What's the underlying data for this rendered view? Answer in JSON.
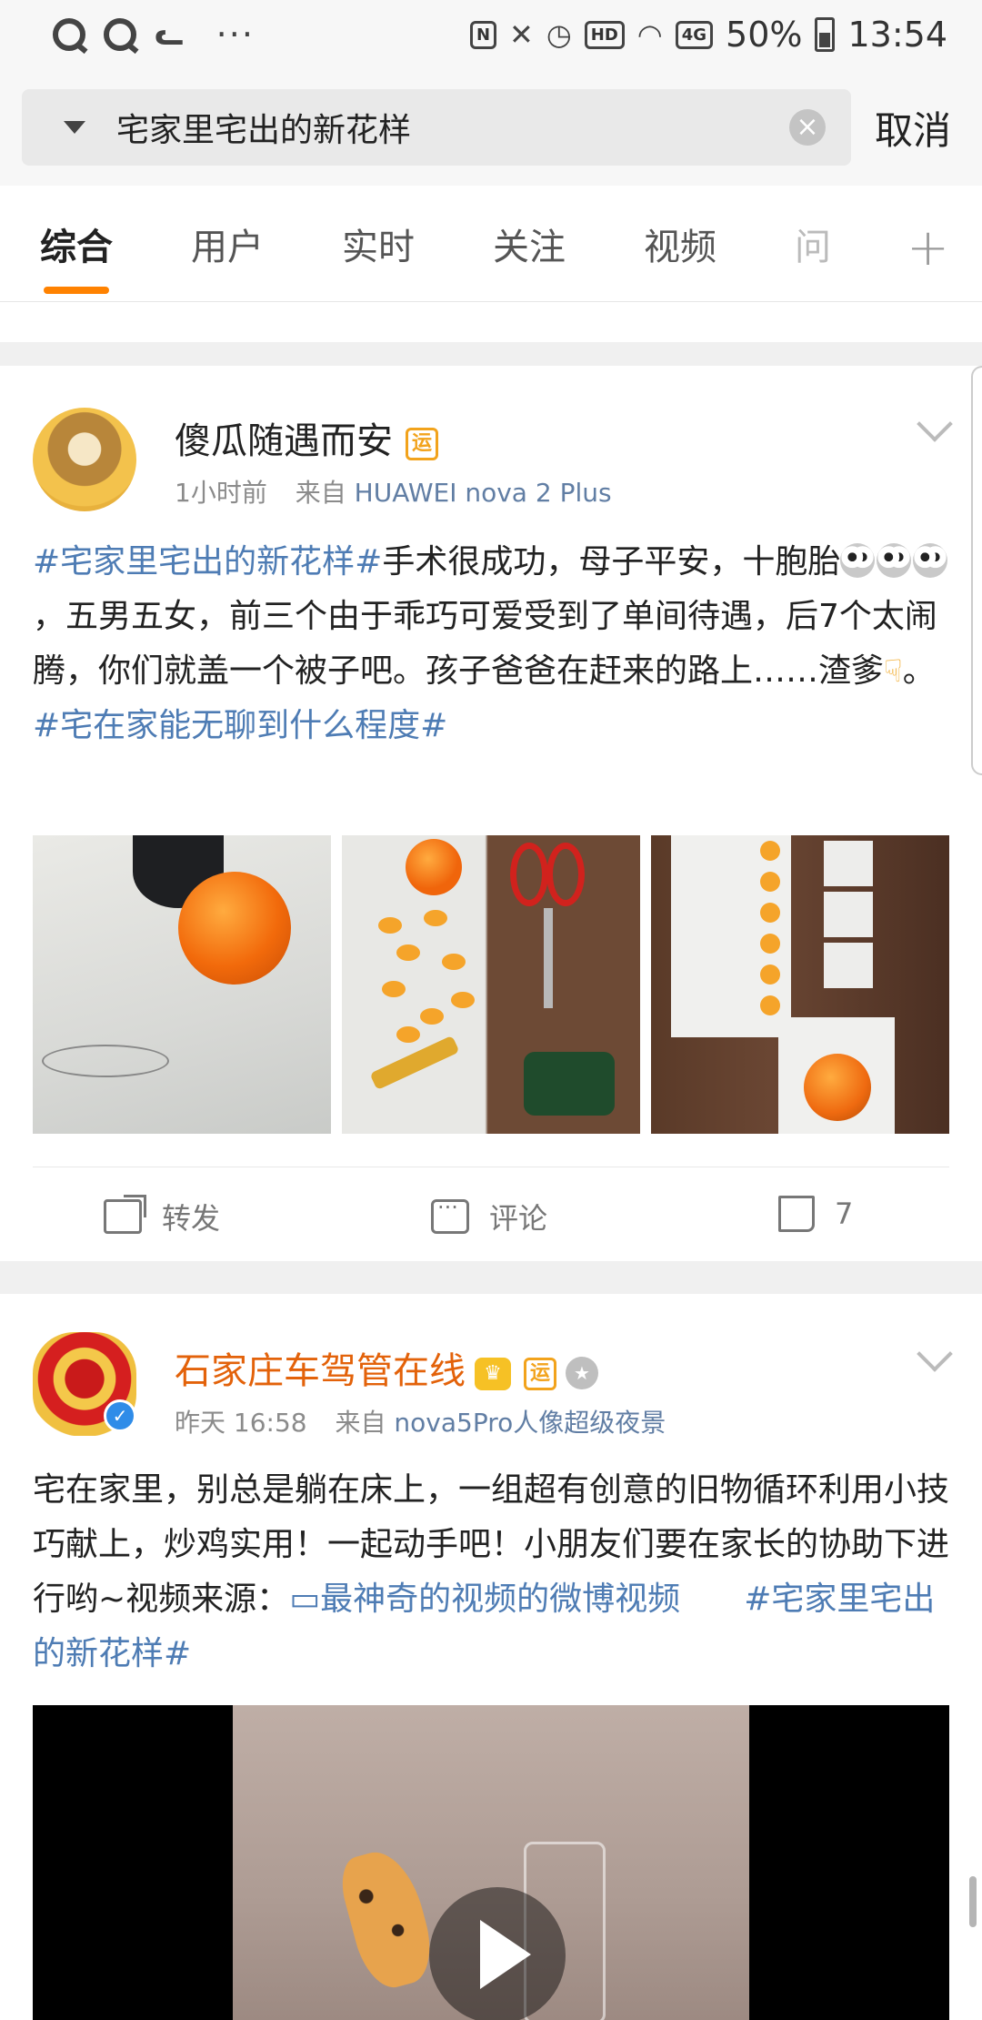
{
  "status_bar": {
    "left_icons": [
      "search-app-icon",
      "search-app-icon",
      "weibo-icon",
      "more-dots-icon"
    ],
    "weibo_glyph": "ᓚ",
    "more": "···",
    "nfc": "N",
    "hd": "HD",
    "net": "4G",
    "battery": "50%",
    "time": "13:54"
  },
  "search": {
    "query": "宅家里宅出的新花样",
    "clear": "×",
    "cancel": "取消"
  },
  "tabs": {
    "items": [
      "综合",
      "用户",
      "实时",
      "关注",
      "视频",
      "问"
    ],
    "active": "综合",
    "plus": "+"
  },
  "posts": [
    {
      "user": "傻瓜随遇而安",
      "badge": "运",
      "time": "1小时前",
      "from": "来自",
      "device": "HUAWEI nova 2 Plus",
      "text": {
        "tag1": "#宅家里宅出的新花样#",
        "body1": "手术很成功，母子平安，十胞胎",
        "body2": "，五男五女，前三个由于乖巧可爱受到了单间待遇，后7个太闹腾，你们就盖一个被子吧。孩子爸爸在赶来的路上……渣爹",
        "body3": "。",
        "tag2": "#宅在家能无聊到什么程度#"
      },
      "actions": {
        "repost": "转发",
        "comment": "评论",
        "likes": "7"
      }
    },
    {
      "user": "石家庄车驾管在线",
      "badge": "运",
      "time": "昨天 16:58",
      "from": "来自",
      "device": "nova5Pro人像超级夜景",
      "text": {
        "body": "宅在家里，别总是躺在床上，一组超有创意的旧物循环利用小技巧献上，炒鸡实用！一起动手吧！小朋友们要在家长的协助下进行哟~视频来源：",
        "link": "▭最神奇的视频的微博视频",
        "tag": "#宅家里宅出的新花样#"
      }
    }
  ],
  "colors": {
    "accent": "#ff8200",
    "link": "#4e7cb4",
    "vip_name": "#e3620a"
  }
}
